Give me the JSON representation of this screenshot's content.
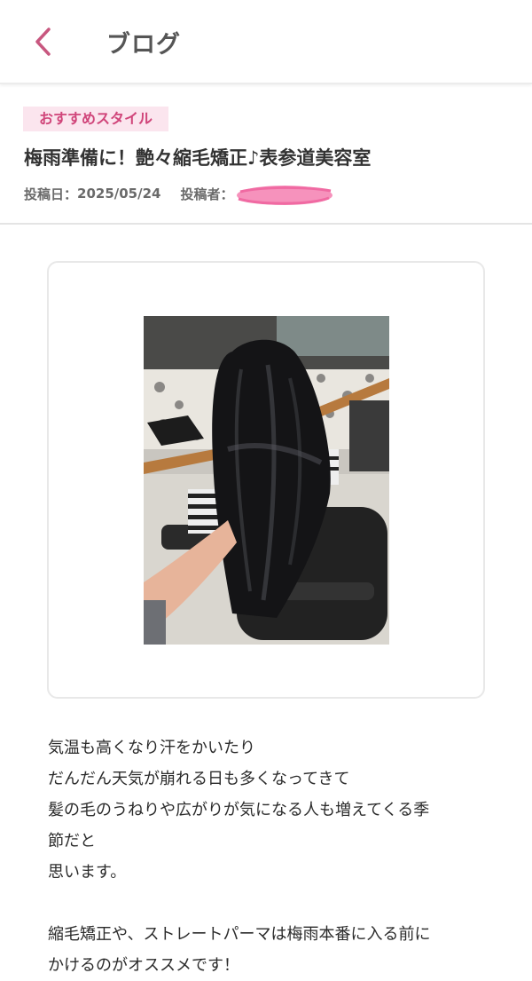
{
  "header": {
    "title": "ブログ",
    "back_icon": "chevron-left-icon",
    "accent_color": "#c8577f"
  },
  "post": {
    "tag": "おすすめスタイル",
    "title": "梅雨準備に！艶々縮毛矯正♪表参道美容室",
    "date_label": "投稿日：",
    "date": "2025/05/24",
    "author_label": "投稿者："
  },
  "body": {
    "lines": [
      "気温も高くなり汗をかいたり",
      "だんだん天気が崩れる日も多くなってきて",
      "髪の毛のうねりや広がりが気になる人も増えてくる季",
      "節だと",
      "思います。",
      "",
      "縮毛矯正や、ストレートパーマは梅雨本番に入る前に",
      "かけるのがオススメです！"
    ]
  },
  "colors": {
    "tag_bg": "#fbe5ee",
    "tag_text": "#d0457a",
    "redaction": "#f57fb0"
  }
}
